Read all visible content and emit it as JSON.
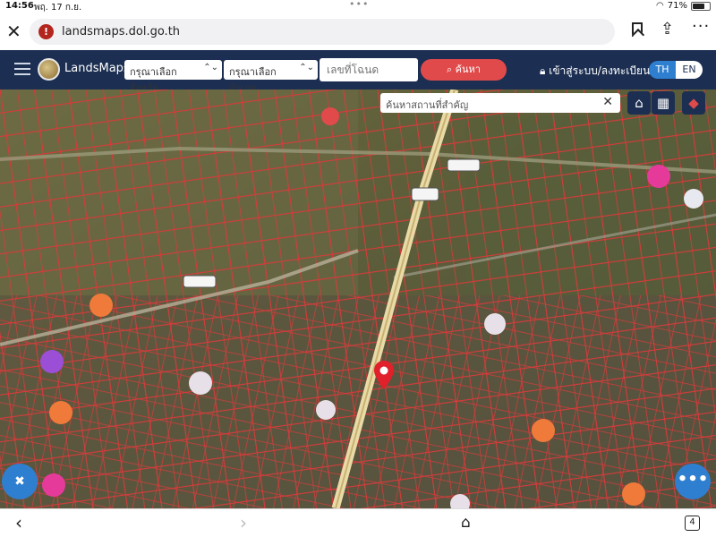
{
  "status_bar": {
    "time": "14:56",
    "date": "พฤ. 17 ก.ย.",
    "battery": "71%",
    "battery_level": 0.71
  },
  "browser": {
    "url": "landsmaps.dol.go.th"
  },
  "app_header": {
    "brand": "LandsMaps",
    "province_select": "กรุณาเลือกจังหวัด",
    "district_select": "กรุณาเลือกอำเภอ",
    "deed_placeholder": "เลขที่โฉนด",
    "search_label": "ค้นหา",
    "login_label": "เข้าสู่ระบบ/ลงทะเบียน",
    "lang_th": "TH",
    "lang_en": "EN"
  },
  "map": {
    "place_search_placeholder": "ค้นหาสถานที่สำคัญ",
    "colors": {
      "parcel_line": "#d83a3a",
      "pin": "#e0202a",
      "poi_orange": "#f07a3a",
      "poi_pink": "#e63a9a",
      "poi_purple": "#9b4fd6",
      "header": "#1c2f52",
      "accent_blue": "#2f7fd1"
    }
  },
  "bottom_bar": {
    "tab_count": "4"
  },
  "icons": [
    "close-icon",
    "warning-icon",
    "bookmark-icon",
    "share-icon",
    "more-icon",
    "hamburger-icon",
    "lock-icon",
    "search-icon",
    "home-icon",
    "grid-icon",
    "layers-icon",
    "pin-icon",
    "accessibility-icon",
    "dots-icon",
    "back-icon",
    "forward-icon",
    "house-icon",
    "tabs-icon"
  ]
}
